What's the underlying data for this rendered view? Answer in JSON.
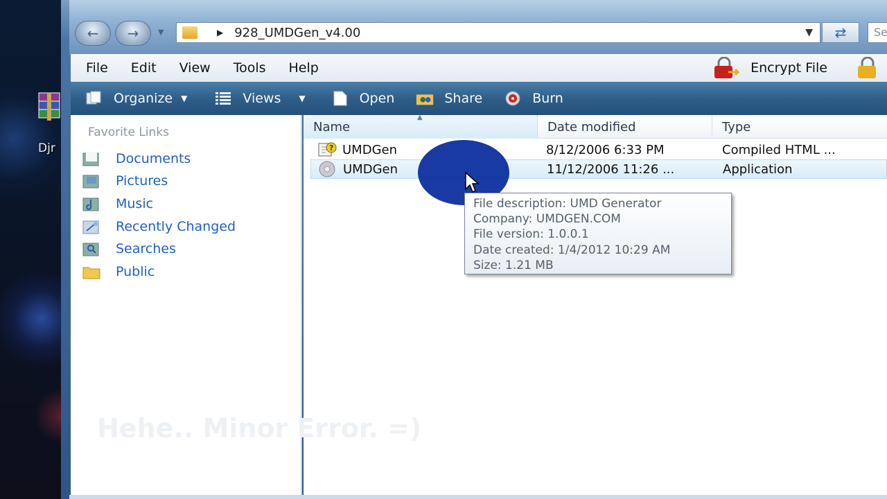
{
  "desktop": {
    "icon_label": "Djr"
  },
  "address_bar": {
    "path": "928_UMDGen_v4.00",
    "search_placeholder": "Se"
  },
  "menu": [
    "File",
    "Edit",
    "View",
    "Tools",
    "Help"
  ],
  "encrypt_label": "Encrypt File",
  "toolbar": [
    {
      "label": "Organize",
      "icon": "organize-icon",
      "dropdown": true
    },
    {
      "label": "Views",
      "icon": "views-icon",
      "dropdown": true
    },
    {
      "label": "Open",
      "icon": "open-icon",
      "dropdown": false
    },
    {
      "label": "Share",
      "icon": "share-icon",
      "dropdown": false
    },
    {
      "label": "Burn",
      "icon": "burn-icon",
      "dropdown": false
    }
  ],
  "nav_pane": {
    "title": "Favorite Links",
    "links": [
      "Documents",
      "Pictures",
      "Music",
      "Recently Changed",
      "Searches",
      "Public"
    ]
  },
  "columns": {
    "name": "Name",
    "date": "Date modified",
    "type": "Type"
  },
  "files": [
    {
      "name": "UMDGen",
      "date": "8/12/2006 6:33 PM",
      "type": "Compiled HTML ...",
      "icon": "help-file-icon"
    },
    {
      "name": "UMDGen",
      "date": "11/12/2006 11:26 ...",
      "type": "Application",
      "icon": "application-icon",
      "selected": true
    }
  ],
  "tooltip": {
    "lines": [
      "File description: UMD Generator",
      "Company: UMDGEN.COM",
      "File version: 1.0.0.1",
      "Date created: 1/4/2012 10:29 AM",
      "Size: 1.21 MB"
    ]
  },
  "watermark": "Hehe.. Minor Error. =)",
  "colors": {
    "link": "#1f60c4",
    "toolbar": "#2f5e88",
    "highlight": "#0d2f9e"
  }
}
